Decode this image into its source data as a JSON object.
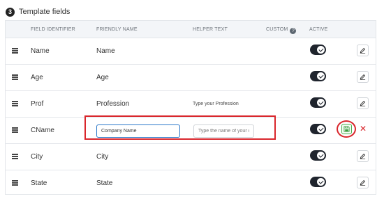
{
  "section": {
    "step_number": "3",
    "title": "Template fields"
  },
  "columns": {
    "field_identifier": "FIELD IDENTIFIER",
    "friendly_name": "FRIENDLY NAME",
    "helper_text": "HELPER TEXT",
    "custom": "CUSTOM",
    "custom_help_icon": "?",
    "active": "ACTIVE"
  },
  "rows": [
    {
      "identifier": "Name",
      "friendly_name": "Name",
      "helper_text": "",
      "active": true
    },
    {
      "identifier": "Age",
      "friendly_name": "Age",
      "helper_text": "",
      "active": true
    },
    {
      "identifier": "Prof",
      "friendly_name": "Profession",
      "helper_text": "Type your Profession",
      "active": true
    },
    {
      "identifier": "CName",
      "friendly_name_value": "Company Name",
      "helper_text_placeholder": "Type the name of your c",
      "active": true,
      "editing": true
    },
    {
      "identifier": "City",
      "friendly_name": "City",
      "helper_text": "",
      "active": true
    },
    {
      "identifier": "State",
      "friendly_name": "State",
      "helper_text": "",
      "active": true
    }
  ],
  "actions": {
    "cancel_glyph": "✕"
  },
  "icons": {
    "drag_handle": "drag-handle-icon",
    "edit": "pencil-icon",
    "save": "floppy-disk-icon",
    "cancel": "close-icon",
    "help": "question-circle-icon"
  },
  "colors": {
    "toggle_on": "#1f242d",
    "highlight": "#d9262c",
    "input_focus": "#2a77c9",
    "save_green": "#4caf50"
  }
}
